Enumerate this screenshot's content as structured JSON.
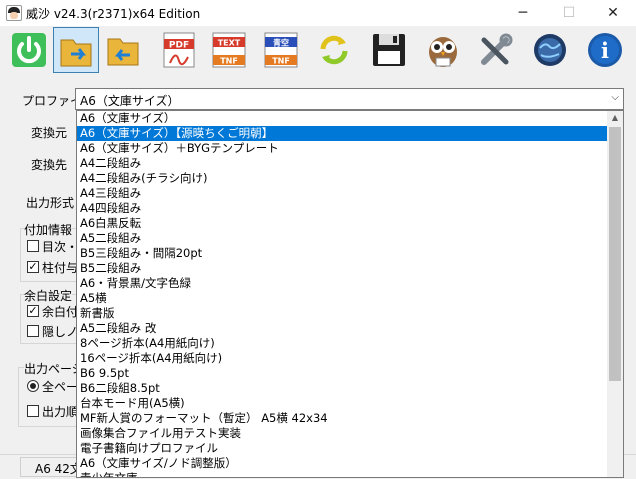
{
  "window": {
    "title": "威沙 v24.3(r2371)x64 Edition",
    "minimize_glyph": "─",
    "maximize_glyph": "☐",
    "close_glyph": "✕"
  },
  "toolbar": {
    "buttons": [
      {
        "name": "power-icon"
      },
      {
        "name": "folder-open-icon"
      },
      {
        "name": "folder-back-icon"
      },
      {
        "name": "pdf-icon",
        "label": "PDF"
      },
      {
        "name": "text-tnf-icon",
        "label": "TEXT",
        "sub": "TNF"
      },
      {
        "name": "aozora-tnf-icon",
        "label": "青空",
        "sub": "TNF"
      },
      {
        "name": "refresh-icon"
      },
      {
        "name": "save-icon"
      },
      {
        "name": "owl-icon"
      },
      {
        "name": "tools-icon"
      },
      {
        "name": "globe-icon"
      },
      {
        "name": "info-icon",
        "label": "i"
      }
    ]
  },
  "form": {
    "profile_label": "プロファイル",
    "profile_value": "A6（文庫サイズ）",
    "dropdown_arrow": "⌵",
    "source_label": "変換元",
    "dest_label": "変換先",
    "output_format_label": "出力形式",
    "extra_info_group": "付加情報",
    "toc_checkbox": "目次・",
    "header_checkbox": "柱付与",
    "margin_group": "余白設定",
    "margin_checkbox": "余白付",
    "hidden_checkbox": "隠しノン",
    "output_page_group": "出力ページ",
    "all_pages_radio": "全ペー",
    "output_order_checkbox": "出力順"
  },
  "check_glyph": "✓",
  "status": {
    "text": "A6 42文"
  },
  "dropdown": {
    "scroll_up_glyph": "▲",
    "selected_index": 1,
    "items": [
      "A6（文庫サイズ）",
      "A6（文庫サイズ）【源暎ちくご明朝】",
      "A6（文庫サイズ）＋BYGテンプレート",
      "A4二段組み",
      "A4二段組み(チラシ向け)",
      "A4三段組み",
      "A4四段組み",
      "A6白黒反転",
      "A5二段組み",
      "B5三段組み・間隔20pt",
      "B5二段組み",
      "A6・背景黒/文字色緑",
      "A5横",
      "新書版",
      "A5二段組み 改",
      "8ページ折本(A4用紙向け)",
      "16ページ折本(A4用紙向け)",
      "B6 9.5pt",
      "B6二段組8.5pt",
      "台本モード用(A5横)",
      "MF新人賞のフォーマット（暫定） A5横 42x34",
      "画像集合ファイル用テスト実装",
      "電子書籍向けプロファイル",
      "A6（文庫サイズ/ノド調整版）",
      "青少年文庫"
    ]
  }
}
